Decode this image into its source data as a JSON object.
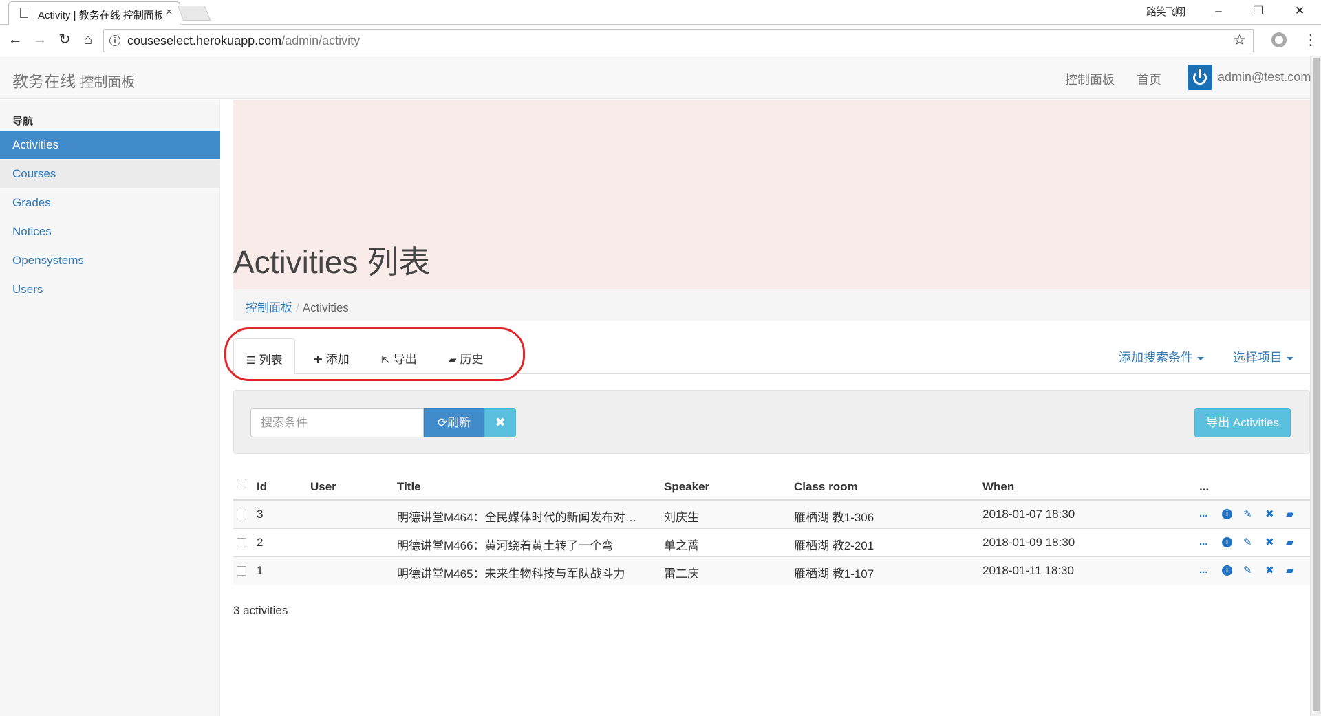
{
  "browser": {
    "tab_title": "Activity | 教务在线 控制面板",
    "tab_close": "×",
    "window_user": "路笑飞翔",
    "window_buttons": {
      "minimize": "–",
      "maximize": "❐",
      "close": "✕"
    },
    "url_host": "couseselect.herokuapp.com",
    "url_path": "/admin/activity"
  },
  "navbar": {
    "brand": "教务在线",
    "brand_sub": "控制面板",
    "links": [
      "控制面板",
      "首页"
    ],
    "user_email": "admin@test.com"
  },
  "sidebar": {
    "header": "导航",
    "items": [
      {
        "label": "Activities",
        "state": "active"
      },
      {
        "label": "Courses",
        "state": "hover"
      },
      {
        "label": "Grades",
        "state": "normal"
      },
      {
        "label": "Notices",
        "state": "normal"
      },
      {
        "label": "Opensystems",
        "state": "normal"
      },
      {
        "label": "Users",
        "state": "normal"
      }
    ]
  },
  "page": {
    "title": "Activities 列表",
    "breadcrumb": {
      "home": "控制面板",
      "separator": "/",
      "current": "Activities"
    }
  },
  "tabs": [
    {
      "icon": "list-icon",
      "glyph": "☰",
      "label": "列表"
    },
    {
      "icon": "plus-icon",
      "glyph": "✚",
      "label": "添加"
    },
    {
      "icon": "share-icon",
      "glyph": "⇱",
      "label": "导出"
    },
    {
      "icon": "book-icon",
      "glyph": "▰",
      "label": "历史"
    }
  ],
  "dropdowns": {
    "filter": "添加搜索条件",
    "columns": "选择项目"
  },
  "search": {
    "placeholder": "搜索条件",
    "refresh_icon": "⟳",
    "refresh_label": "刷新",
    "clear_icon": "✖",
    "export_label": "导出 Activities"
  },
  "table": {
    "columns": [
      "Id",
      "User",
      "Title",
      "Speaker",
      "Class room",
      "When",
      "..."
    ],
    "rows": [
      {
        "id": "3",
        "user": "",
        "title": "明德讲堂M464：全民媒体时代的新闻发布对…",
        "speaker": "刘庆生",
        "room": "雁栖湖 教1-306",
        "when": "2018-01-07 18:30"
      },
      {
        "id": "2",
        "user": "",
        "title": "明德讲堂M466：黄河绕着黄土转了一个弯",
        "speaker": "单之蔷",
        "room": "雁栖湖 教2-201",
        "when": "2018-01-09 18:30"
      },
      {
        "id": "1",
        "user": "",
        "title": "明德讲堂M465：未来生物科技与军队战斗力",
        "speaker": "雷二庆",
        "room": "雁栖湖 教1-107",
        "when": "2018-01-11 18:30"
      }
    ],
    "row_actions": {
      "more": "...",
      "info": "i",
      "edit": "✎",
      "delete": "✖",
      "history": "▰"
    }
  },
  "footer": {
    "count": "3 activities"
  },
  "colors": {
    "primary": "#428bca",
    "info": "#5bc0de",
    "jumbotron": "#f9ebe9",
    "highlight": "#e0252b"
  }
}
